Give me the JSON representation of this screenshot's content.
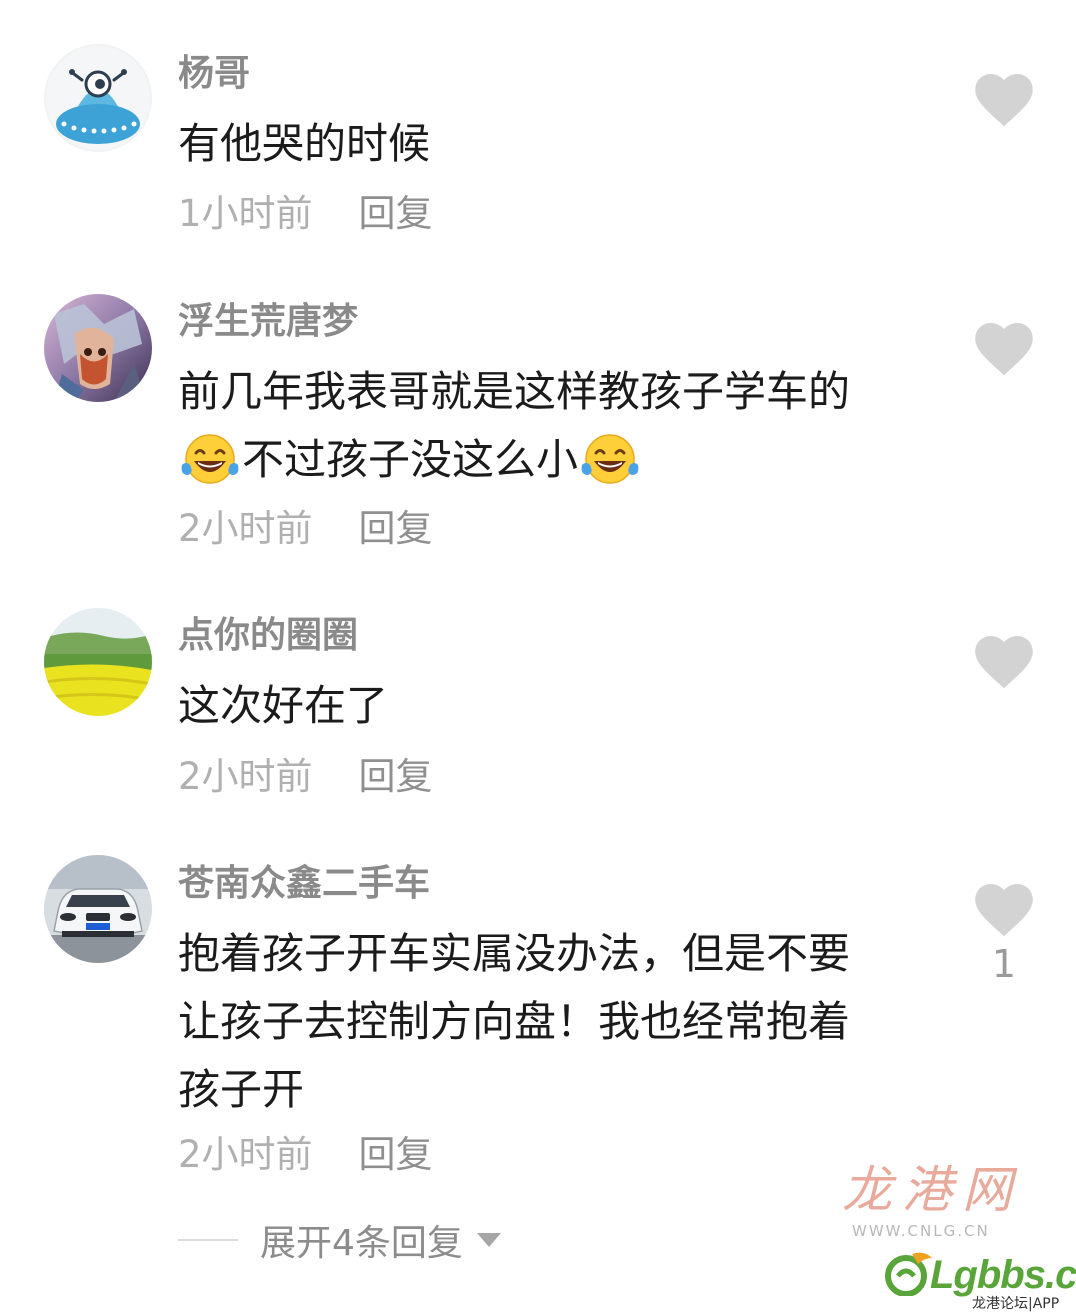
{
  "comments": [
    {
      "username": "杨哥",
      "lines": [
        "有他哭的时候"
      ],
      "time": "1小时前",
      "reply": "回复",
      "avatar_icon": "alien-ufo-avatar"
    },
    {
      "username": "浮生荒唐梦",
      "lines": [
        "前几年我表哥就是这样教孩子学车的",
        "不过孩子没这么小"
      ],
      "time": "2小时前",
      "reply": "回复",
      "avatar_icon": "anime-character-avatar",
      "emoji": "tears-of-joy-emoji"
    },
    {
      "username": "点你的圈圈",
      "lines": [
        "这次好在了"
      ],
      "time": "2小时前",
      "reply": "回复",
      "avatar_icon": "landscape-field-avatar"
    },
    {
      "username": "苍南众鑫二手车",
      "lines": [
        "抱着孩子开车实属没办法，但是不要",
        "让孩子去控制方向盘！我也经常抱着",
        "孩子开"
      ],
      "time": "2小时前",
      "reply": "回复",
      "avatar_icon": "white-car-avatar",
      "like_count": "1"
    }
  ],
  "expand_replies": "展开4条回复",
  "like_icon": "heart-icon",
  "watermarks": {
    "cnlg_title": "龙港网",
    "cnlg_url": "WWW.CNLG.CN",
    "lgbbs_text": "Lgbbs.cn",
    "lgbbs_sub": "龙港论坛|APP"
  },
  "colors": {
    "username": "#8a8a8a",
    "content": "#1b1b1b",
    "time": "#b0b0b0",
    "heart": "#d3d3d3"
  }
}
